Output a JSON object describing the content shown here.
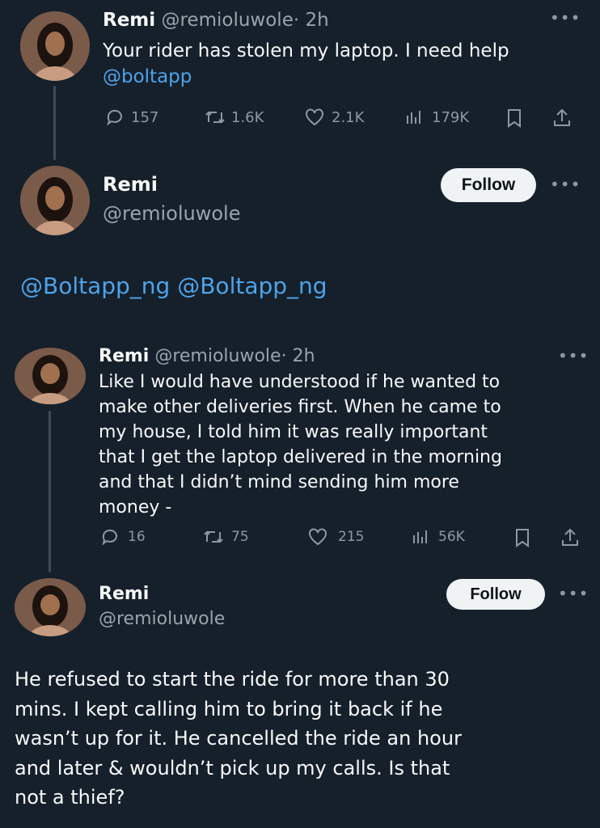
{
  "tweets": [
    {
      "name": "Remi",
      "handle": "@remioluwole",
      "time": "· 2h",
      "text": "Your rider has stolen my laptop. I need help",
      "mention": "@boltapp",
      "replies": "157",
      "retweets": "1.6K",
      "likes": "2.1K",
      "views": "179K"
    },
    {
      "name": "Remi",
      "handle": "@remioluwole",
      "follow": "Follow",
      "text": "@Boltapp_ng @Boltapp_ng"
    },
    {
      "name": "Remi",
      "handle": "@remioluwole",
      "time": "· 2h",
      "lines": [
        "Like I would have understood if he wanted to",
        "make other deliveries first. When he came to",
        "my house, I told him it was really important",
        "that I get the laptop delivered in the morning",
        "and that I didn’t mind sending him more",
        "money -"
      ],
      "replies": "16",
      "retweets": "75",
      "likes": "215",
      "views": "56K"
    },
    {
      "name": "Remi",
      "handle": "@remioluwole",
      "follow": "Follow",
      "lines": [
        "He refused to start the ride for more than 30",
        "mins. I kept calling him to bring it back if he",
        "wasn’t up for it.  He cancelled the ride an hour",
        "and later & wouldn’t pick up my calls. Is that",
        "not a thief?"
      ]
    }
  ],
  "icons": {
    "reply": "reply-icon",
    "retweet": "retweet-icon",
    "like": "heart-icon",
    "views": "views-icon",
    "bookmark": "bookmark-icon",
    "share": "share-icon",
    "more": "more-icon"
  },
  "colors": {
    "background": "#15202b",
    "link": "#4ea3e8",
    "muted": "#9aa4ad"
  }
}
